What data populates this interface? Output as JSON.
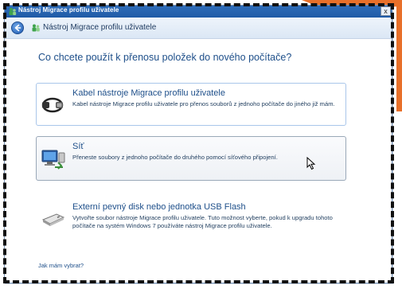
{
  "window": {
    "title": "Nástroj Migrace profilu uživatele",
    "close_glyph": "x"
  },
  "navbar": {
    "title": "Nástroj Migrace profilu uživatele"
  },
  "main": {
    "question": "Co chcete použít k přenosu položek do nového počítače?",
    "options": [
      {
        "title": "Kabel nástroje Migrace profilu uživatele",
        "description": "Kabel nástroje Migrace profilu uživatele pro přenos souborů z jednoho počítače do jiného již mám.",
        "icon": "cable-icon"
      },
      {
        "title": "Síť",
        "description": "Přeneste soubory z jednoho počítače do druhého pomocí síťového připojení.",
        "icon": "network-icon"
      },
      {
        "title": "Externí pevný disk nebo jednotka USB Flash",
        "description": "Vytvořte soubor nástroje Migrace profilu uživatele. Tuto možnost vyberte, pokud k upgradu tohoto počítače na systém Windows 7 používáte nástroj Migrace profilu uživatele.",
        "icon": "usb-drive-icon"
      }
    ],
    "help_link": "Jak mám vybrat?"
  },
  "colors": {
    "accent_blue": "#1e4f8a",
    "titlebar": "#2f6db9",
    "decoration_orange": "#e8702a"
  }
}
